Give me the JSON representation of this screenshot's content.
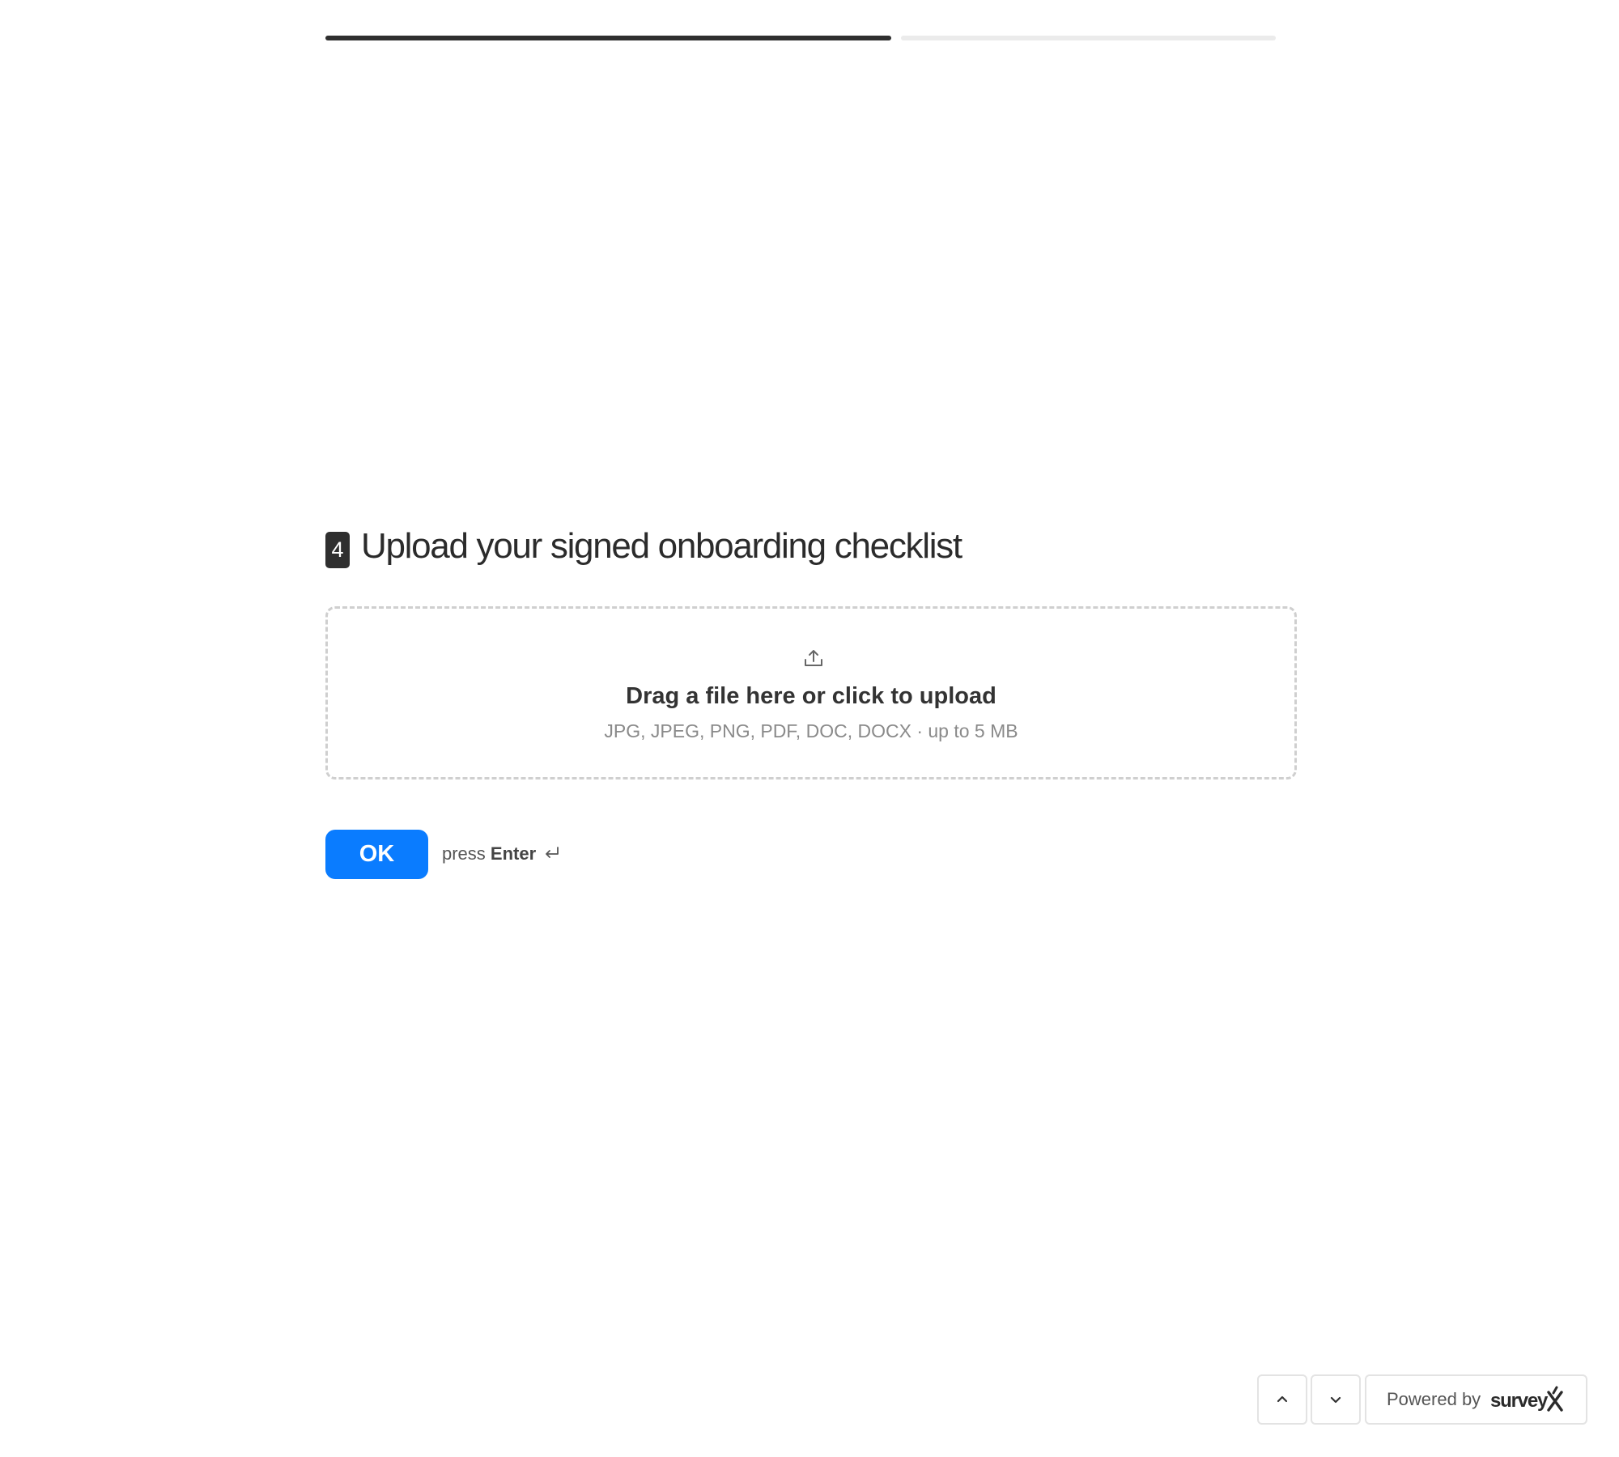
{
  "progress": {
    "completed_fraction": 0.6
  },
  "question": {
    "number": "4",
    "title": "Upload your signed onboarding checklist"
  },
  "dropzone": {
    "icon": "upload-icon",
    "primary_text": "Drag a file here or click to upload",
    "secondary_text": "JPG, JPEG, PNG, PDF, DOC, DOCX · up to 5 MB"
  },
  "actions": {
    "ok_label": "OK",
    "hint_prefix": "press",
    "hint_key": "Enter",
    "hint_icon": "enter-return-icon"
  },
  "footer": {
    "nav_up_icon": "chevron-up-icon",
    "nav_down_icon": "chevron-down-icon",
    "powered_by_label": "Powered by",
    "brand_name": "surveyX"
  },
  "colors": {
    "accent": "#0a7cff",
    "progress_done": "#2f2f2f",
    "progress_todo": "#ebebeb"
  }
}
